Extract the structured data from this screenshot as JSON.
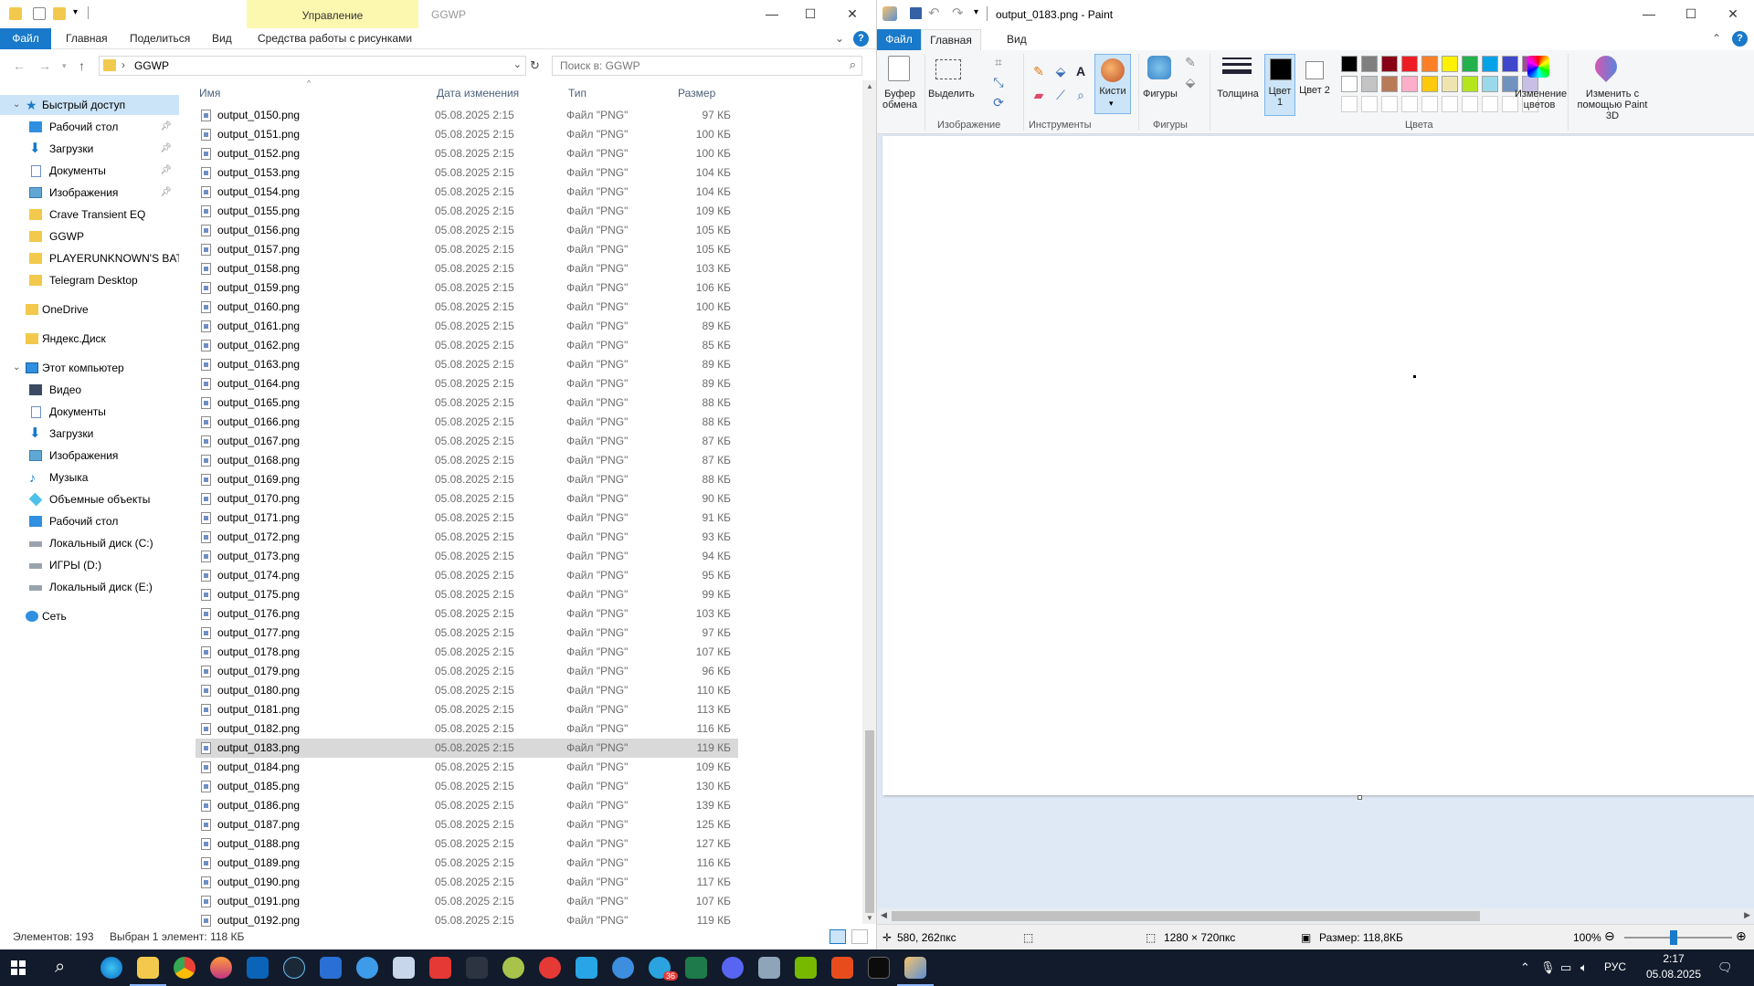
{
  "explorer": {
    "title": "GGWP",
    "context_tab": "Управление",
    "ribbon_tabs": {
      "file": "Файл",
      "home": "Главная",
      "share": "Поделиться",
      "view": "Вид",
      "picture_tools": "Средства работы с рисунками"
    },
    "address": {
      "path": "GGWP",
      "search_placeholder": "Поиск в: GGWP"
    },
    "nav": {
      "quick_access": "Быстрый доступ",
      "qa_items": [
        {
          "label": "Рабочий стол",
          "pinned": "true"
        },
        {
          "label": "Загрузки",
          "pinned": "true"
        },
        {
          "label": "Документы",
          "pinned": "true"
        },
        {
          "label": "Изображения",
          "pinned": "true"
        },
        {
          "label": "Crave Transient EQ"
        },
        {
          "label": "GGWP"
        },
        {
          "label": "PLAYERUNKNOWN'S BATTL"
        },
        {
          "label": "Telegram Desktop"
        }
      ],
      "onedrive": "OneDrive",
      "yandex": "Яндекс.Диск",
      "this_pc": "Этот компьютер",
      "pc_items": [
        "Видео",
        "Документы",
        "Загрузки",
        "Изображения",
        "Музыка",
        "Объемные объекты",
        "Рабочий стол",
        "Локальный диск (C:)",
        "ИГРЫ (D:)",
        "Локальный диск (E:)"
      ],
      "network": "Сеть"
    },
    "columns": {
      "name": "Имя",
      "date": "Дата изменения",
      "type": "Тип",
      "size": "Размер"
    },
    "file_date": "05.08.2025 2:15",
    "file_type": "Файл \"PNG\"",
    "files": [
      [
        "output_0150.png",
        "97 КБ"
      ],
      [
        "output_0151.png",
        "100 КБ"
      ],
      [
        "output_0152.png",
        "100 КБ"
      ],
      [
        "output_0153.png",
        "104 КБ"
      ],
      [
        "output_0154.png",
        "104 КБ"
      ],
      [
        "output_0155.png",
        "109 КБ"
      ],
      [
        "output_0156.png",
        "105 КБ"
      ],
      [
        "output_0157.png",
        "105 КБ"
      ],
      [
        "output_0158.png",
        "103 КБ"
      ],
      [
        "output_0159.png",
        "106 КБ"
      ],
      [
        "output_0160.png",
        "100 КБ"
      ],
      [
        "output_0161.png",
        "89 КБ"
      ],
      [
        "output_0162.png",
        "85 КБ"
      ],
      [
        "output_0163.png",
        "89 КБ"
      ],
      [
        "output_0164.png",
        "89 КБ"
      ],
      [
        "output_0165.png",
        "88 КБ"
      ],
      [
        "output_0166.png",
        "88 КБ"
      ],
      [
        "output_0167.png",
        "87 КБ"
      ],
      [
        "output_0168.png",
        "87 КБ"
      ],
      [
        "output_0169.png",
        "88 КБ"
      ],
      [
        "output_0170.png",
        "90 КБ"
      ],
      [
        "output_0171.png",
        "91 КБ"
      ],
      [
        "output_0172.png",
        "93 КБ"
      ],
      [
        "output_0173.png",
        "94 КБ"
      ],
      [
        "output_0174.png",
        "95 КБ"
      ],
      [
        "output_0175.png",
        "99 КБ"
      ],
      [
        "output_0176.png",
        "103 КБ"
      ],
      [
        "output_0177.png",
        "97 КБ"
      ],
      [
        "output_0178.png",
        "107 КБ"
      ],
      [
        "output_0179.png",
        "96 КБ"
      ],
      [
        "output_0180.png",
        "110 КБ"
      ],
      [
        "output_0181.png",
        "113 КБ"
      ],
      [
        "output_0182.png",
        "116 КБ"
      ],
      [
        "output_0183.png",
        "119 КБ"
      ],
      [
        "output_0184.png",
        "109 КБ"
      ],
      [
        "output_0185.png",
        "130 КБ"
      ],
      [
        "output_0186.png",
        "139 КБ"
      ],
      [
        "output_0187.png",
        "125 КБ"
      ],
      [
        "output_0188.png",
        "127 КБ"
      ],
      [
        "output_0189.png",
        "116 КБ"
      ],
      [
        "output_0190.png",
        "117 КБ"
      ],
      [
        "output_0191.png",
        "107 КБ"
      ],
      [
        "output_0192.png",
        "119 КБ"
      ]
    ],
    "selected_file": "output_0183.png",
    "status": {
      "count": "Элементов: 193",
      "selected": "Выбран 1 элемент: 118 КБ"
    }
  },
  "paint": {
    "title": "output_0183.png - Paint",
    "tabs": {
      "file": "Файл",
      "home": "Главная",
      "view": "Вид"
    },
    "ribbon": {
      "clipboard": "Буфер обмена",
      "select": "Выделить",
      "image_group": "Изображение",
      "tools_group": "Инструменты",
      "brushes": "Кисти",
      "shapes": "Фигуры",
      "shapes_group": "Фигуры",
      "thickness": "Толщина",
      "color1": "Цвет 1",
      "color2": "Цвет 2",
      "colors_group": "Цвета",
      "edit_colors": "Изменение цветов",
      "paint3d": "Изменить с помощью Paint 3D"
    },
    "palette": [
      "#000000",
      "#7f7f7f",
      "#880015",
      "#ed1c24",
      "#ff7f27",
      "#fff200",
      "#22b14c",
      "#00a2e8",
      "#3f48cc",
      "#a349a4",
      "#ffffff",
      "#c3c3c3",
      "#b97a57",
      "#ffaec9",
      "#ffc90e",
      "#efe4b0",
      "#b5e61d",
      "#99d9ea",
      "#7092be",
      "#c8bfe7"
    ],
    "status": {
      "cursor": "580, 262пкс",
      "dimensions": "1280 × 720пкс",
      "size": "Размер: 118,8КБ",
      "zoom": "100%"
    }
  },
  "taskbar": {
    "language": "РУС",
    "time": "2:17",
    "date": "05.08.2025",
    "badge": "36"
  }
}
